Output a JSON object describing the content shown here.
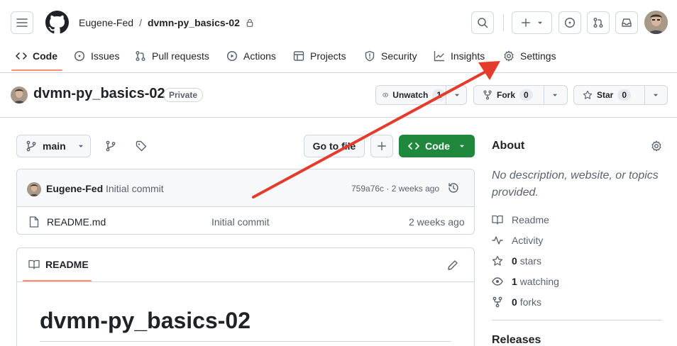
{
  "header": {
    "owner": "Eugene-Fed",
    "separator": "/",
    "repo": "dvmn-py_basics-02"
  },
  "tabs": [
    {
      "label": "Code",
      "icon": "code-icon"
    },
    {
      "label": "Issues",
      "icon": "issue-icon"
    },
    {
      "label": "Pull requests",
      "icon": "pull-request-icon"
    },
    {
      "label": "Actions",
      "icon": "play-icon"
    },
    {
      "label": "Projects",
      "icon": "table-icon"
    },
    {
      "label": "Security",
      "icon": "shield-icon"
    },
    {
      "label": "Insights",
      "icon": "graph-icon"
    },
    {
      "label": "Settings",
      "icon": "gear-icon"
    }
  ],
  "repo_header": {
    "name": "dvmn-py_basics-02",
    "visibility": "Private",
    "unwatch_label": "Unwatch",
    "unwatch_count": "1",
    "fork_label": "Fork",
    "fork_count": "0",
    "star_label": "Star",
    "star_count": "0"
  },
  "toolbar": {
    "branch": "main",
    "go_to_file": "Go to file",
    "code_label": "Code"
  },
  "commit": {
    "author": "Eugene-Fed",
    "message": "Initial commit",
    "hash_time": "759a76c · 2 weeks ago"
  },
  "files": [
    {
      "name": "README.md",
      "message": "Initial commit",
      "time": "2 weeks ago"
    }
  ],
  "readme": {
    "tab_label": "README",
    "heading": "dvmn-py_basics-02"
  },
  "about": {
    "title": "About",
    "description": "No description, website, or topics provided.",
    "readme": "Readme",
    "activity": "Activity",
    "stars_count": "0",
    "stars_label": "stars",
    "watching_count": "1",
    "watching_label": "watching",
    "forks_count": "0",
    "forks_label": "forks",
    "releases_title": "Releases"
  },
  "colors": {
    "accent_underline": "#fd8c73",
    "code_button": "#1f883d",
    "annotation_arrow": "#e53b2c"
  }
}
